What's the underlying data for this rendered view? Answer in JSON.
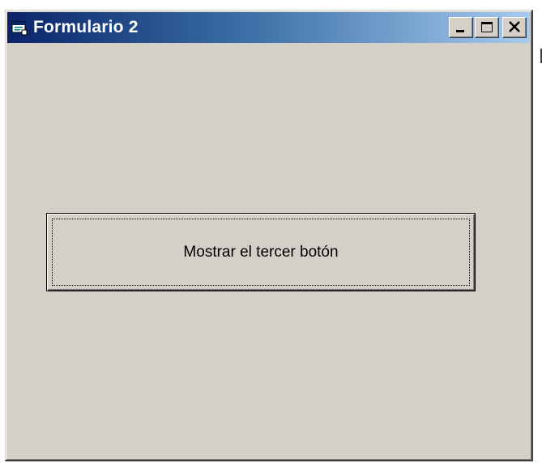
{
  "window": {
    "title": "Formulario 2",
    "icon": "form-icon",
    "controls": {
      "minimize_icon": "minimize-icon",
      "maximize_icon": "maximize-icon",
      "close_icon": "close-icon"
    }
  },
  "form": {
    "command_button_label": "Mostrar el tercer botón"
  },
  "colors": {
    "face": "#d4d0c8",
    "title_start": "#0a246a",
    "title_end": "#a6caf0",
    "title_text": "#ffffff"
  }
}
